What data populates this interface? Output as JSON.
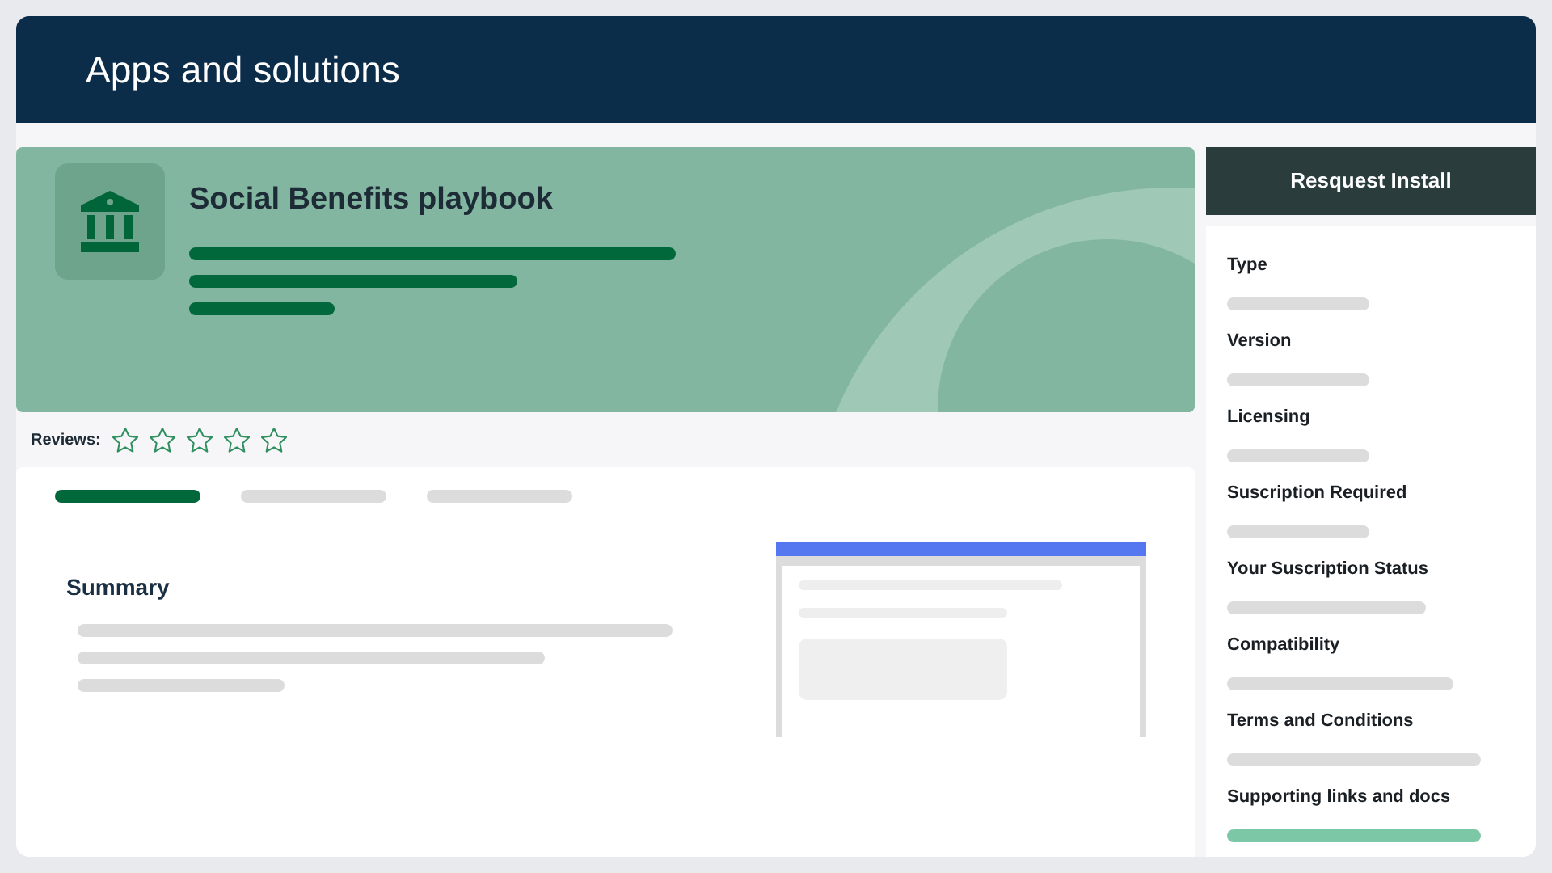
{
  "header": {
    "title": "Apps and solutions"
  },
  "app": {
    "title": "Social Benefits playbook"
  },
  "reviews": {
    "label": "Reviews:",
    "stars": 0
  },
  "tabs": [
    {
      "selected": true
    },
    {
      "selected": false
    },
    {
      "selected": false
    }
  ],
  "summary": {
    "title": "Summary"
  },
  "install_button": "Resquest Install",
  "details": [
    {
      "label": "Type",
      "kind": "placeholder"
    },
    {
      "label": "Version",
      "kind": "placeholder"
    },
    {
      "label": "Licensing",
      "kind": "placeholder"
    },
    {
      "label": "Suscription Required",
      "kind": "placeholder"
    },
    {
      "label": "Your Suscription Status",
      "kind": "placeholder"
    },
    {
      "label": "Compatibility",
      "kind": "placeholder"
    },
    {
      "label": "Terms and Conditions",
      "kind": "placeholder"
    },
    {
      "label": "Supporting links and docs",
      "kind": "link"
    }
  ]
}
